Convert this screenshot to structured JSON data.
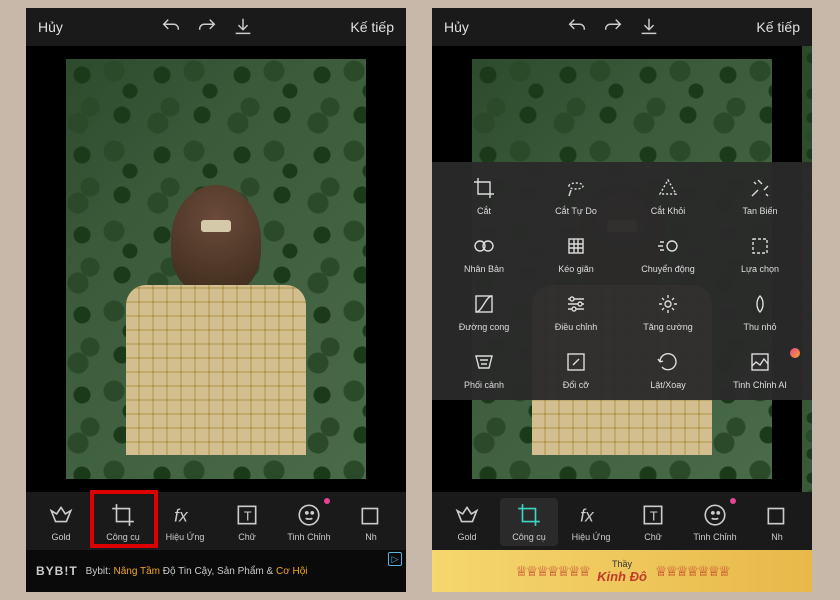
{
  "topbar": {
    "cancel": "Hủy",
    "next": "Kế tiếp"
  },
  "tools": {
    "gold": "Gold",
    "congcu": "Công cụ",
    "hieuung": "Hiệu Ứng",
    "chu": "Chữ",
    "tinhchinh": "Tinh Chỉnh",
    "nhan": "Nh"
  },
  "panel": {
    "cat": "Cắt",
    "cattudo": "Cắt Tự Do",
    "catkhoi": "Cắt Khỏi",
    "tanbien": "Tan Biến",
    "nhanban": "Nhân Bản",
    "keogian": "Kéo giãn",
    "chuyendong": "Chuyển động",
    "luachon": "Lựa chọn",
    "duongcong": "Đường cong",
    "dieuchinh": "Điều chỉnh",
    "tangcuong": "Tăng cường",
    "thunho": "Thu nhỏ",
    "phoicanh": "Phối cảnh",
    "doico": "Đổi cỡ",
    "latxoay": "Lật/Xoay",
    "tinhchinhai": "Tinh Chỉnh AI"
  },
  "ad1": {
    "logo": "BYB!T",
    "pre": "Bybit: ",
    "hl1": "Nâng Tầm",
    "mid": " Độ Tin Cậy, Sản Phẩm & ",
    "hl2": "Cơ Hội"
  },
  "ad2": {
    "line1": "Thầy",
    "line2": "Kinh Đô"
  }
}
